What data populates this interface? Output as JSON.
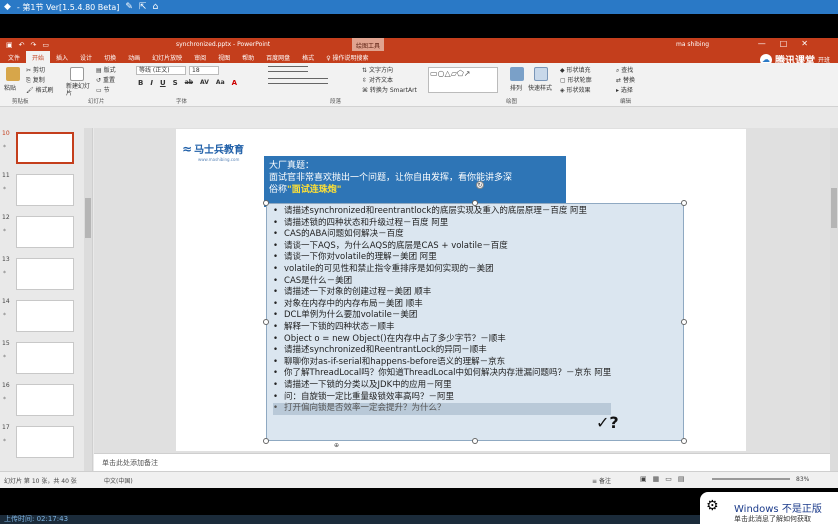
{
  "player": {
    "title": "- 第1节 Ver[1.5.4.80 Beta]",
    "icons": [
      "app-icon",
      "edit-icon",
      "share-icon",
      "home-icon"
    ]
  },
  "ppt": {
    "qa_icons": [
      "save-icon",
      "undo-icon",
      "redo-icon",
      "present-icon"
    ],
    "filename": "synchronized.pptx",
    "app": "PowerPoint",
    "context_tool": "绘图工具",
    "user": "ma shibing",
    "brand": "腾讯课堂",
    "brand_suffix": "开班",
    "tabs": [
      "文件",
      "开始",
      "插入",
      "设计",
      "切换",
      "动画",
      "幻灯片放映",
      "审阅",
      "视图",
      "帮助",
      "百度网盘",
      "格式",
      "操作说明搜索"
    ],
    "active_tab": "开始"
  },
  "ribbon": {
    "clipboard": {
      "paste": "粘贴",
      "cut": "剪切",
      "copy": "复制",
      "format_painter": "格式刷",
      "label": "剪贴板"
    },
    "slides": {
      "new_slide": "新建幻灯片",
      "layout": "版式",
      "reset": "重置",
      "section": "节",
      "label": "幻灯片"
    },
    "font": {
      "name": "等线 (正文)",
      "size": "18",
      "label": "字体",
      "buttons": [
        "B",
        "I",
        "U",
        "S",
        "ab",
        "AV",
        "Aa",
        "A"
      ]
    },
    "paragraph": {
      "text_direction": "文字方向",
      "align_text": "对齐文本",
      "smartart": "转换为 SmartArt",
      "label": "段落"
    },
    "drawing": {
      "arrange": "排列",
      "quick_styles": "快速样式",
      "fill": "形状填充",
      "outline": "形状轮廓",
      "effects": "形状效果",
      "label": "绘图"
    },
    "editing": {
      "find": "查找",
      "replace": "替换",
      "select": "选择",
      "label": "编辑"
    }
  },
  "thumbnails": [
    {
      "num": "10",
      "active": true
    },
    {
      "num": "11",
      "active": false
    },
    {
      "num": "12",
      "active": false
    },
    {
      "num": "13",
      "active": false
    },
    {
      "num": "14",
      "active": false
    },
    {
      "num": "15",
      "active": false
    },
    {
      "num": "16",
      "active": false
    },
    {
      "num": "17",
      "active": false
    }
  ],
  "slide": {
    "logo": "马士兵教育",
    "logo_sub": "www.mashibing.com",
    "banner_line1": "大厂真题：",
    "banner_line2": "面试官非常喜欢抛出一个问题，让你自由发挥，看你能讲多深",
    "banner_line3_prefix": "俗称",
    "banner_highlight": "\"面试连珠炮\"",
    "questions": [
      "请描述synchronized和reentrantlock的底层实现及重入的底层原理－百度 阿里",
      "请描述锁的四种状态和升级过程－百度 阿里",
      "CAS的ABA问题如何解决－百度",
      "请谈一下AQS，为什么AQS的底层是CAS + volatile－百度",
      "请谈一下你对volatile的理解－美团 阿里",
      "volatile的可见性和禁止指令重排序是如何实现的－美团",
      "CAS是什么－美团",
      "请描述一下对象的创建过程－美团 顺丰",
      "对象在内存中的内存布局－美团 顺丰",
      "DCL单例为什么要加volatile－美团",
      "解释一下锁的四种状态－顺丰",
      "Object o = new Object()在内存中占了多少字节？－顺丰",
      "请描述synchronized和ReentrantLock的异同－顺丰",
      "聊聊你对as-if-serial和happens-before语义的理解－京东",
      "你了解ThreadLocal吗？你知道ThreadLocal中如何解决内存泄漏问题吗？－京东 阿里",
      "请描述一下锁的分类以及JDK中的应用－阿里",
      "问：自旋锁一定比重量级锁效率高吗？－阿里",
      "打开偏向锁是否效率一定会提升？为什么？"
    ],
    "notes_placeholder": "单击此处添加备注"
  },
  "status": {
    "left": "幻灯片 第 10 张，共 40 张",
    "lang": "中文(中国)",
    "notes_btn": "备注",
    "zoom": "83%"
  },
  "activation": {
    "title": "Windows 不是正版",
    "subtitle": "单击此消息了解如何获取"
  },
  "bottom": {
    "text": "上传时间: 02:17:43"
  }
}
